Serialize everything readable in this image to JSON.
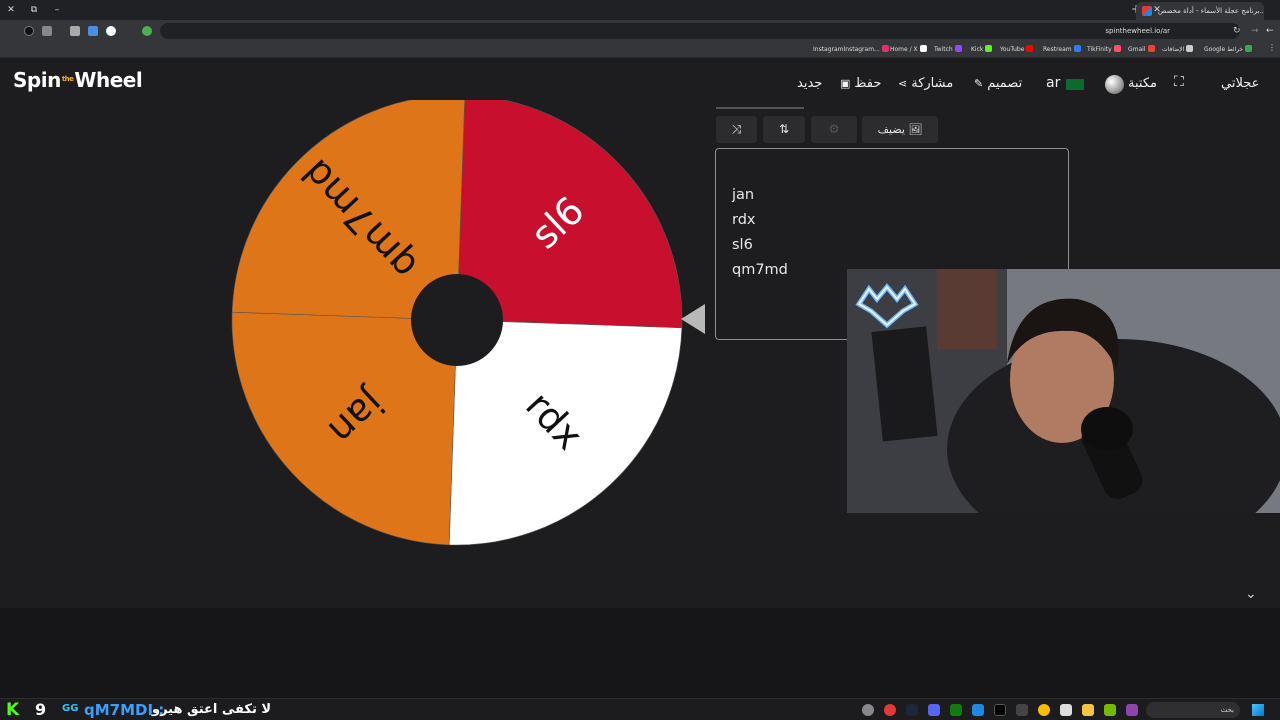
{
  "browser": {
    "tab_title": "برنامج عجلة الأسماء - أداة مخصص...",
    "url": "spinthewheel.io/ar",
    "new_tab": "+",
    "minimize": "–",
    "restore": "⧉",
    "close_win": "✕",
    "tab_close": "✕",
    "bookmarks": [
      {
        "label": "InstagramInstagram...",
        "color": "#e1306c"
      },
      {
        "label": "Home / X",
        "color": "#ffffff"
      },
      {
        "label": "Twitch",
        "color": "#9146ff"
      },
      {
        "label": "Kick",
        "color": "#53fc18"
      },
      {
        "label": "YouTube",
        "color": "#ff0000"
      },
      {
        "label": "Restream",
        "color": "#2f7cf6"
      },
      {
        "label": "TikFinity",
        "color": "#ff4d6d"
      },
      {
        "label": "Gmail",
        "color": "#ea4335"
      },
      {
        "label": "الإضافات",
        "color": "#cccccc"
      },
      {
        "label": "Google خرائط",
        "color": "#34a853"
      }
    ]
  },
  "header": {
    "logo_spin": "Spin",
    "logo_the": "the",
    "logo_wheel": "Wheel",
    "new": "جديد",
    "save": "حفظ",
    "share": "مشاركة",
    "design": "تصميم",
    "lang": "ar",
    "library": "مكتبة",
    "wheels": "عجلاتي"
  },
  "toolbar": {
    "shuffle_icon": "⤨",
    "sort_icon": "⇅",
    "settings_icon": "⚙",
    "add_image_icon": "🖼",
    "add_label": "يضيف"
  },
  "entries": [
    "jan",
    "rdx",
    "sl6",
    "qm7md"
  ],
  "wheel": {
    "segments": [
      {
        "label": "sl6",
        "color": "#c8102e",
        "text_color": "#ffffff"
      },
      {
        "label": "rdx",
        "color": "#ffffff",
        "text_color": "#111111"
      },
      {
        "label": "jan",
        "color": "#de7518",
        "text_color": "#111111"
      },
      {
        "label": "qm7md",
        "color": "#de7518",
        "text_color": "#111111"
      }
    ]
  },
  "page": {
    "chevron": "⌄"
  },
  "taskbar": {
    "kick_letter": "K",
    "viewer_count": "9",
    "badge": "GG",
    "chat_user": "qM7MDI :",
    "chat_message": "لا تكفى اعتق هيرو",
    "search_label": "بحث"
  }
}
